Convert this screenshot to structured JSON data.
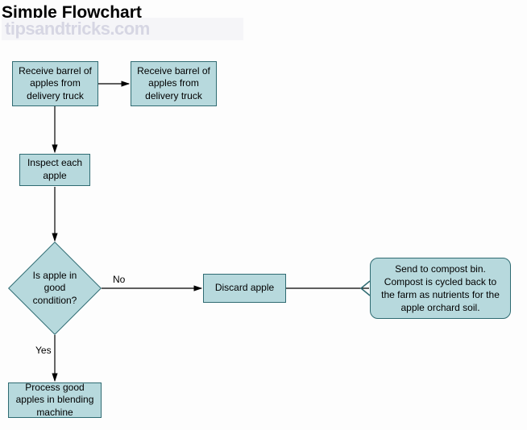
{
  "title": "Simple Flowchart",
  "watermark": "tipsandtricks.com",
  "nodes": {
    "receive1": "Receive barrel of apples from delivery truck",
    "receive2": "Receive barrel of apples from delivery truck",
    "inspect": "Inspect each apple",
    "decision": "Is apple in good condition?",
    "discard": "Discard apple",
    "process": "Process good apples in blending machine",
    "compost": "Send to compost bin. Compost is cycled back to the farm as nutrients for the apple orchard soil."
  },
  "edges": {
    "no_label": "No",
    "yes_label": "Yes"
  },
  "colors": {
    "fill": "#b7d9dd",
    "stroke": "#2f6b72"
  },
  "flow": [
    {
      "from": "receive1",
      "to": "receive2"
    },
    {
      "from": "receive1",
      "to": "inspect"
    },
    {
      "from": "inspect",
      "to": "decision"
    },
    {
      "from": "decision",
      "to": "discard",
      "label": "No"
    },
    {
      "from": "decision",
      "to": "process",
      "label": "Yes"
    },
    {
      "from": "discard",
      "to": "compost"
    }
  ]
}
